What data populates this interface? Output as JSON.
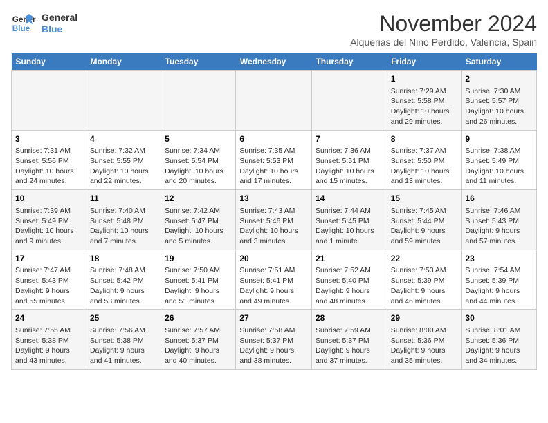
{
  "logo": {
    "line1": "General",
    "line2": "Blue"
  },
  "title": "November 2024",
  "location": "Alquerias del Nino Perdido, Valencia, Spain",
  "weekdays": [
    "Sunday",
    "Monday",
    "Tuesday",
    "Wednesday",
    "Thursday",
    "Friday",
    "Saturday"
  ],
  "weeks": [
    [
      {
        "day": "",
        "info": ""
      },
      {
        "day": "",
        "info": ""
      },
      {
        "day": "",
        "info": ""
      },
      {
        "day": "",
        "info": ""
      },
      {
        "day": "",
        "info": ""
      },
      {
        "day": "1",
        "info": "Sunrise: 7:29 AM\nSunset: 5:58 PM\nDaylight: 10 hours and 29 minutes."
      },
      {
        "day": "2",
        "info": "Sunrise: 7:30 AM\nSunset: 5:57 PM\nDaylight: 10 hours and 26 minutes."
      }
    ],
    [
      {
        "day": "3",
        "info": "Sunrise: 7:31 AM\nSunset: 5:56 PM\nDaylight: 10 hours and 24 minutes."
      },
      {
        "day": "4",
        "info": "Sunrise: 7:32 AM\nSunset: 5:55 PM\nDaylight: 10 hours and 22 minutes."
      },
      {
        "day": "5",
        "info": "Sunrise: 7:34 AM\nSunset: 5:54 PM\nDaylight: 10 hours and 20 minutes."
      },
      {
        "day": "6",
        "info": "Sunrise: 7:35 AM\nSunset: 5:53 PM\nDaylight: 10 hours and 17 minutes."
      },
      {
        "day": "7",
        "info": "Sunrise: 7:36 AM\nSunset: 5:51 PM\nDaylight: 10 hours and 15 minutes."
      },
      {
        "day": "8",
        "info": "Sunrise: 7:37 AM\nSunset: 5:50 PM\nDaylight: 10 hours and 13 minutes."
      },
      {
        "day": "9",
        "info": "Sunrise: 7:38 AM\nSunset: 5:49 PM\nDaylight: 10 hours and 11 minutes."
      }
    ],
    [
      {
        "day": "10",
        "info": "Sunrise: 7:39 AM\nSunset: 5:49 PM\nDaylight: 10 hours and 9 minutes."
      },
      {
        "day": "11",
        "info": "Sunrise: 7:40 AM\nSunset: 5:48 PM\nDaylight: 10 hours and 7 minutes."
      },
      {
        "day": "12",
        "info": "Sunrise: 7:42 AM\nSunset: 5:47 PM\nDaylight: 10 hours and 5 minutes."
      },
      {
        "day": "13",
        "info": "Sunrise: 7:43 AM\nSunset: 5:46 PM\nDaylight: 10 hours and 3 minutes."
      },
      {
        "day": "14",
        "info": "Sunrise: 7:44 AM\nSunset: 5:45 PM\nDaylight: 10 hours and 1 minute."
      },
      {
        "day": "15",
        "info": "Sunrise: 7:45 AM\nSunset: 5:44 PM\nDaylight: 9 hours and 59 minutes."
      },
      {
        "day": "16",
        "info": "Sunrise: 7:46 AM\nSunset: 5:43 PM\nDaylight: 9 hours and 57 minutes."
      }
    ],
    [
      {
        "day": "17",
        "info": "Sunrise: 7:47 AM\nSunset: 5:43 PM\nDaylight: 9 hours and 55 minutes."
      },
      {
        "day": "18",
        "info": "Sunrise: 7:48 AM\nSunset: 5:42 PM\nDaylight: 9 hours and 53 minutes."
      },
      {
        "day": "19",
        "info": "Sunrise: 7:50 AM\nSunset: 5:41 PM\nDaylight: 9 hours and 51 minutes."
      },
      {
        "day": "20",
        "info": "Sunrise: 7:51 AM\nSunset: 5:41 PM\nDaylight: 9 hours and 49 minutes."
      },
      {
        "day": "21",
        "info": "Sunrise: 7:52 AM\nSunset: 5:40 PM\nDaylight: 9 hours and 48 minutes."
      },
      {
        "day": "22",
        "info": "Sunrise: 7:53 AM\nSunset: 5:39 PM\nDaylight: 9 hours and 46 minutes."
      },
      {
        "day": "23",
        "info": "Sunrise: 7:54 AM\nSunset: 5:39 PM\nDaylight: 9 hours and 44 minutes."
      }
    ],
    [
      {
        "day": "24",
        "info": "Sunrise: 7:55 AM\nSunset: 5:38 PM\nDaylight: 9 hours and 43 minutes."
      },
      {
        "day": "25",
        "info": "Sunrise: 7:56 AM\nSunset: 5:38 PM\nDaylight: 9 hours and 41 minutes."
      },
      {
        "day": "26",
        "info": "Sunrise: 7:57 AM\nSunset: 5:37 PM\nDaylight: 9 hours and 40 minutes."
      },
      {
        "day": "27",
        "info": "Sunrise: 7:58 AM\nSunset: 5:37 PM\nDaylight: 9 hours and 38 minutes."
      },
      {
        "day": "28",
        "info": "Sunrise: 7:59 AM\nSunset: 5:37 PM\nDaylight: 9 hours and 37 minutes."
      },
      {
        "day": "29",
        "info": "Sunrise: 8:00 AM\nSunset: 5:36 PM\nDaylight: 9 hours and 35 minutes."
      },
      {
        "day": "30",
        "info": "Sunrise: 8:01 AM\nSunset: 5:36 PM\nDaylight: 9 hours and 34 minutes."
      }
    ]
  ]
}
